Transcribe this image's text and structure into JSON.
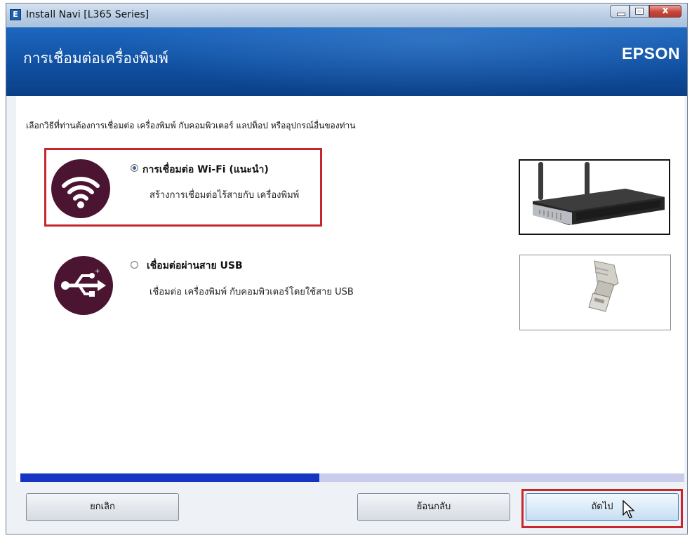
{
  "window": {
    "title": "Install Navi [L365 Series]",
    "app_icon_letter": "E",
    "close_glyph": "x"
  },
  "header": {
    "title": "การเชื่อมต่อเครื่องพิมพ์",
    "brand": "EPSON"
  },
  "main": {
    "instruction": "เลือกวิธีที่ท่านต้องการเชื่อมต่อ เครื่องพิมพ์ กับคอมพิวเตอร์ แลปท็อป หรืออุปกรณ์อื่นของท่าน",
    "options": [
      {
        "title": "การเชื่อมต่อ Wi-Fi (แนะนำ)",
        "description": "สร้างการเชื่อมต่อไร้สายกับ เครื่องพิมพ์",
        "selected": true,
        "icon": "wifi-icon",
        "image": "wireless-router-image"
      },
      {
        "title": "เชื่อมต่อผ่านสาย USB",
        "description": "เชื่อมต่อ เครื่องพิมพ์ กับคอมพิวเตอร์โดยใช้สาย USB",
        "selected": false,
        "icon": "usb-icon",
        "image": "usb-cable-image"
      }
    ]
  },
  "progress": {
    "fraction": 0.45
  },
  "footer": {
    "cancel_label": "ยกเลิก",
    "back_label": "ย้อนกลับ",
    "next_label": "ถัดไป"
  },
  "colors": {
    "accent_dark": "#4b1531",
    "highlight": "#c8262c",
    "banner_blue": "#0f4e9f",
    "progress_fill": "#1734c2",
    "progress_track": "#c9ccea"
  }
}
